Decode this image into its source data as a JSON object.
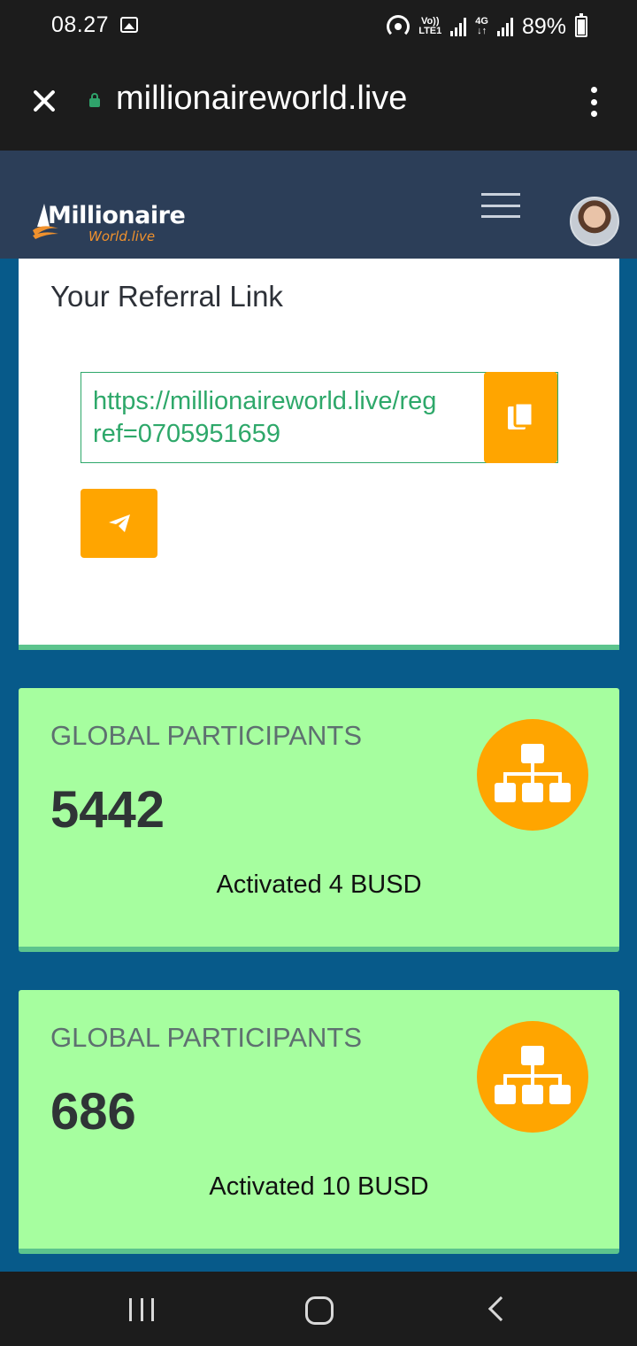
{
  "status_bar": {
    "time": "08.27",
    "network_top": "Vo))",
    "network_bottom": "LTE1",
    "network2_top": "4G",
    "network2_bottom": "↓↑",
    "battery": "89%"
  },
  "browser": {
    "url": "millionaireworld.live"
  },
  "site": {
    "logo_main": "Millionaire",
    "logo_sub": "World.live"
  },
  "referral": {
    "title": "Your Referral Link",
    "link_line1": "https://millionaireworld.live/reg",
    "link_line2": "ref=0705951659"
  },
  "stats": [
    {
      "label": "GLOBAL PARTICIPANTS",
      "value": "5442",
      "sub": "Activated 4 BUSD"
    },
    {
      "label": "GLOBAL PARTICIPANTS",
      "value": "686",
      "sub": "Activated 10 BUSD"
    }
  ],
  "colors": {
    "accent": "#ffa500",
    "card_green": "#a6fe9f",
    "link_green": "#2ea86a",
    "page_bg": "#075a8a",
    "header_bg": "#2c3e58"
  },
  "icons": {
    "close": "close-icon",
    "lock": "lock-icon",
    "menu": "more-vert-icon",
    "hamburger": "hamburger-icon",
    "copy": "copy-icon",
    "send": "telegram-send-icon",
    "stat": "sitemap-icon"
  }
}
